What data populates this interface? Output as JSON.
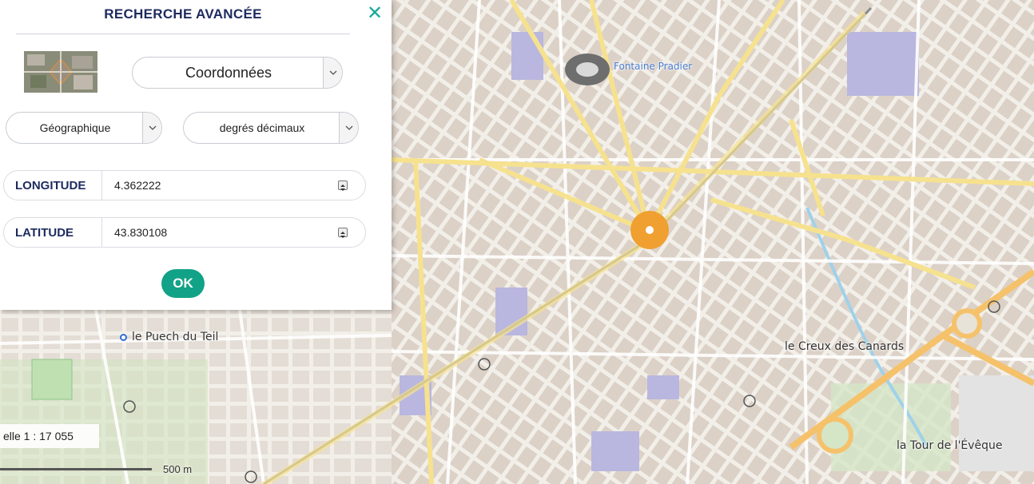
{
  "panel": {
    "title": "RECHERCHE AVANCÉE",
    "close_glyph": "✕",
    "search_mode": "Coordonnées",
    "system": "Géographique",
    "unit": "degrés décimaux",
    "longitude_label": "LONGITUDE",
    "longitude_value": "4.362222",
    "latitude_label": "LATITUDE",
    "latitude_value": "43.830108",
    "ok_label": "OK",
    "accent_color": "#12a287",
    "title_color": "#1d2a5e"
  },
  "map": {
    "labels": {
      "fontaine": "Fontaine Pradier",
      "puech": "le Puech du Teil",
      "creux": "le Creux des Canards",
      "tour": "la Tour de l'Évêque"
    },
    "scale_text": "elle 1 : 17 055",
    "scale_distance": "500 m",
    "marker_color": "#f0a030"
  }
}
